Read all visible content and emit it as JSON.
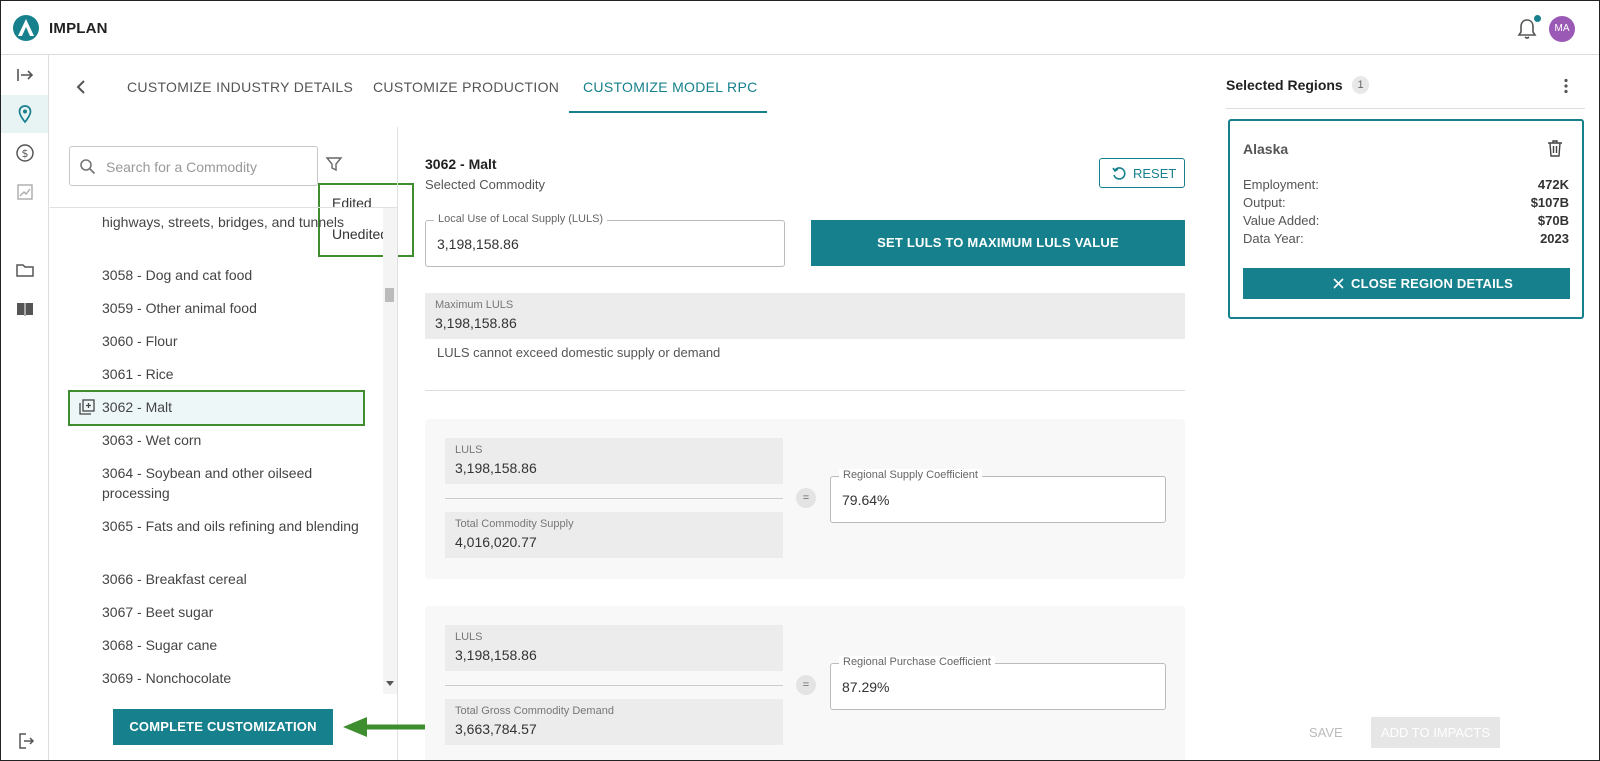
{
  "app": {
    "name": "IMPLAN",
    "user_initials": "MA"
  },
  "tabs": [
    {
      "label": "CUSTOMIZE INDUSTRY DETAILS"
    },
    {
      "label": "CUSTOMIZE PRODUCTION"
    },
    {
      "label": "CUSTOMIZE MODEL RPC"
    }
  ],
  "search": {
    "placeholder": "Search for a Commodity"
  },
  "filter_menu": {
    "items": [
      "Edited",
      "Unedited"
    ]
  },
  "commodities": [
    {
      "label": "highways, streets, bridges, and tunnels"
    },
    {
      "label": "3058 - Dog and cat food"
    },
    {
      "label": "3059 - Other animal food"
    },
    {
      "label": "3060 - Flour"
    },
    {
      "label": "3061 - Rice"
    },
    {
      "label": "3062 - Malt"
    },
    {
      "label": "3063 - Wet corn"
    },
    {
      "label": "3064 - Soybean and other oilseed processing"
    },
    {
      "label": "3065 - Fats and oils refining and blending"
    },
    {
      "label": "3066 - Breakfast cereal"
    },
    {
      "label": "3067 - Beet sugar"
    },
    {
      "label": "3068 - Sugar cane"
    },
    {
      "label": "3069 - Nonchocolate"
    }
  ],
  "complete_label": "COMPLETE CUSTOMIZATION",
  "detail": {
    "title": "3062 - Malt",
    "subtitle": "Selected Commodity",
    "reset_label": "RESET",
    "luls_field": {
      "label": "Local Use of Local Supply (LULS)",
      "value": "3,198,158.86"
    },
    "set_max_label": "SET LULS TO MAXIMUM LULS VALUE",
    "max_luls": {
      "label": "Maximum LULS",
      "value": "3,198,158.86"
    },
    "note": "LULS cannot exceed domestic supply or demand",
    "rsc": {
      "luls_label": "LULS",
      "luls_value": "3,198,158.86",
      "denom_label": "Total Commodity Supply",
      "denom_value": "4,016,020.77",
      "eq": "=",
      "result_label": "Regional Supply Coefficient",
      "result_value": "79.64%"
    },
    "rpc": {
      "luls_label": "LULS",
      "luls_value": "3,198,158.86",
      "denom_label": "Total Gross Commodity Demand",
      "denom_value": "3,663,784.57",
      "eq": "=",
      "result_label": "Regional Purchase Coefficient",
      "result_value": "87.29%"
    }
  },
  "regions": {
    "title": "Selected Regions",
    "count": "1",
    "card": {
      "name": "Alaska",
      "stats": [
        {
          "label": "Employment:",
          "value": "472K"
        },
        {
          "label": "Output:",
          "value": "$107B"
        },
        {
          "label": "Value Added:",
          "value": "$70B"
        },
        {
          "label": "Data Year:",
          "value": "2023"
        }
      ],
      "close_label": "CLOSE REGION DETAILS"
    },
    "save_label": "SAVE",
    "add_label": "ADD TO IMPACTS"
  },
  "colors": {
    "accent": "#16808c",
    "highlight_border": "#3e8e2f",
    "avatar": "#9b59b6"
  }
}
